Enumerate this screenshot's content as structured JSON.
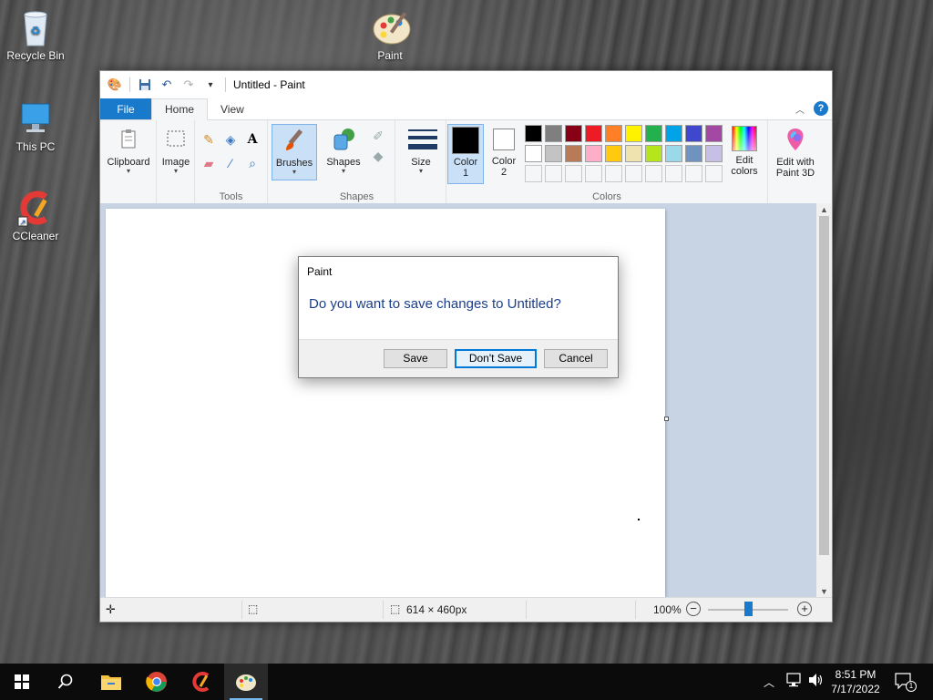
{
  "desktop": {
    "icons": [
      {
        "label": "Recycle Bin",
        "icon": "recycle-bin-icon"
      },
      {
        "label": "Paint",
        "icon": "paint-palette-icon"
      },
      {
        "label": "This PC",
        "icon": "computer-icon"
      },
      {
        "label": "CCleaner",
        "icon": "ccleaner-icon"
      }
    ]
  },
  "window": {
    "title": "Untitled - Paint",
    "tabs": {
      "file": "File",
      "home": "Home",
      "view": "View"
    },
    "ribbon": {
      "clipboard": "Clipboard",
      "image": "Image",
      "tools_group": "Tools",
      "brushes": "Brushes",
      "shapes": "Shapes",
      "shapes_group": "Shapes",
      "size": "Size",
      "color1": "Color\n1",
      "color1_a": "Color",
      "color1_b": "1",
      "color2_a": "Color",
      "color2_b": "2",
      "colors_group": "Colors",
      "edit_colors_a": "Edit",
      "edit_colors_b": "colors",
      "edit3d_a": "Edit with",
      "edit3d_b": "Paint 3D",
      "palette_row1": [
        "#000000",
        "#7f7f7f",
        "#880015",
        "#ed1c24",
        "#ff7f27",
        "#fff200",
        "#22b14c",
        "#00a2e8",
        "#3f48cc",
        "#a349a4"
      ],
      "palette_row2": [
        "#ffffff",
        "#c3c3c3",
        "#b97a57",
        "#ffaec9",
        "#ffc90e",
        "#efe4b0",
        "#b5e61d",
        "#99d9ea",
        "#7092be",
        "#c8bfe7"
      ],
      "color1_value": "#000000",
      "color2_value": "#ffffff"
    },
    "status": {
      "canvas_size": "614 × 460px",
      "zoom": "100%"
    }
  },
  "dialog": {
    "title": "Paint",
    "message": "Do you want to save changes to Untitled?",
    "save": "Save",
    "dont_save": "Don't Save",
    "cancel": "Cancel"
  },
  "taskbar": {
    "time": "8:51 PM",
    "date": "7/17/2022",
    "notification_count": "1"
  }
}
